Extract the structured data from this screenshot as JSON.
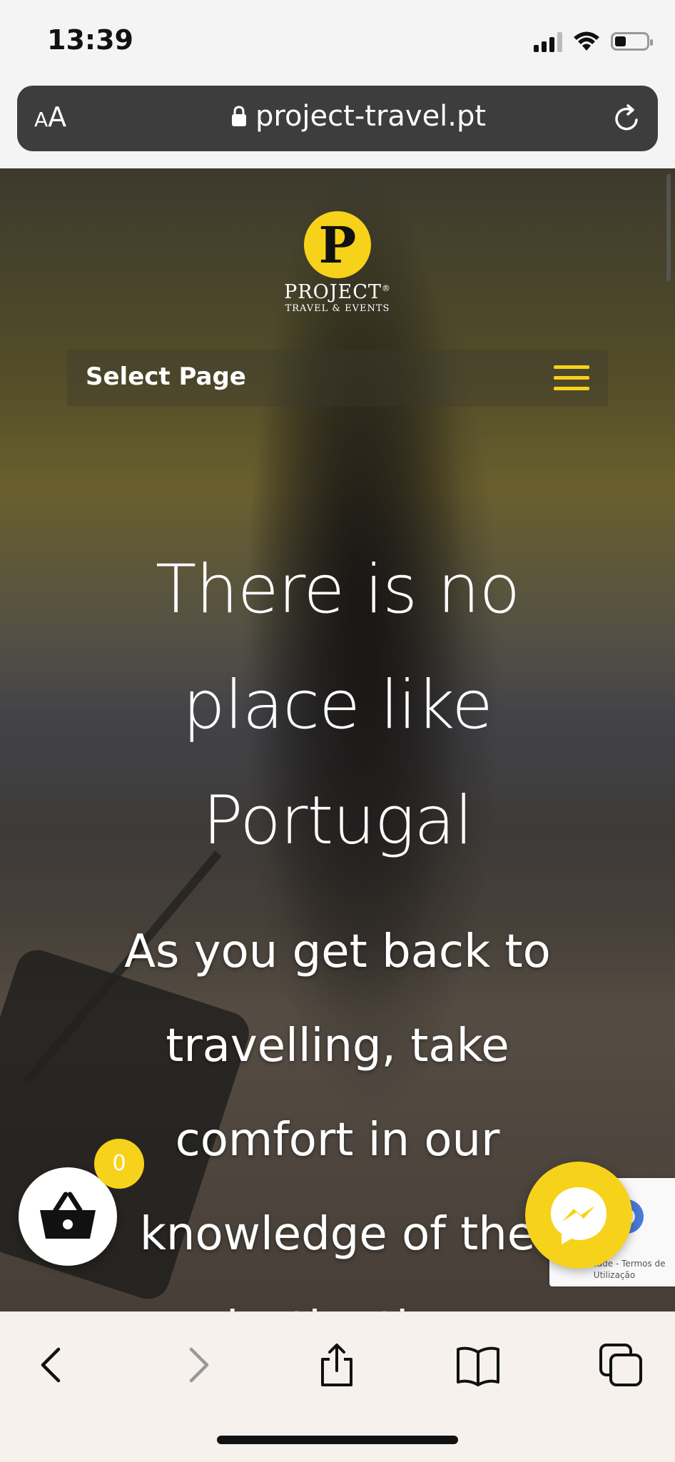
{
  "status_bar": {
    "time": "13:39",
    "icons": [
      "cellular-signal-icon",
      "wifi-icon",
      "battery-icon"
    ]
  },
  "browser": {
    "text_size_label_small": "A",
    "text_size_label_large": "A",
    "url": "project-travel.pt",
    "icons": [
      "lock-icon",
      "reload-icon"
    ]
  },
  "site": {
    "logo": {
      "letter": "P",
      "name": "PROJECT",
      "registered": "®",
      "tagline": "TRAVEL & EVENTS"
    },
    "nav": {
      "select_page_label": "Select Page",
      "menu_icon": "hamburger-menu-icon"
    },
    "hero": {
      "title": "There is no place like Portugal",
      "subtitle": "As you get back to travelling, take comfort in our knowledge of the destination"
    },
    "cart": {
      "count": "0",
      "icon": "shopping-basket-icon"
    },
    "recaptcha": {
      "links": "Privacidade - Termos de Utilização"
    },
    "messenger": {
      "icon": "messenger-icon"
    }
  },
  "colors": {
    "brand_yellow": "#f7d21a",
    "url_bar": "#3d3d3d",
    "toolbar": "#f6f1ec"
  },
  "toolbar": {
    "icons": [
      "back-icon",
      "forward-icon",
      "share-icon",
      "bookmarks-icon",
      "tabs-icon"
    ]
  }
}
